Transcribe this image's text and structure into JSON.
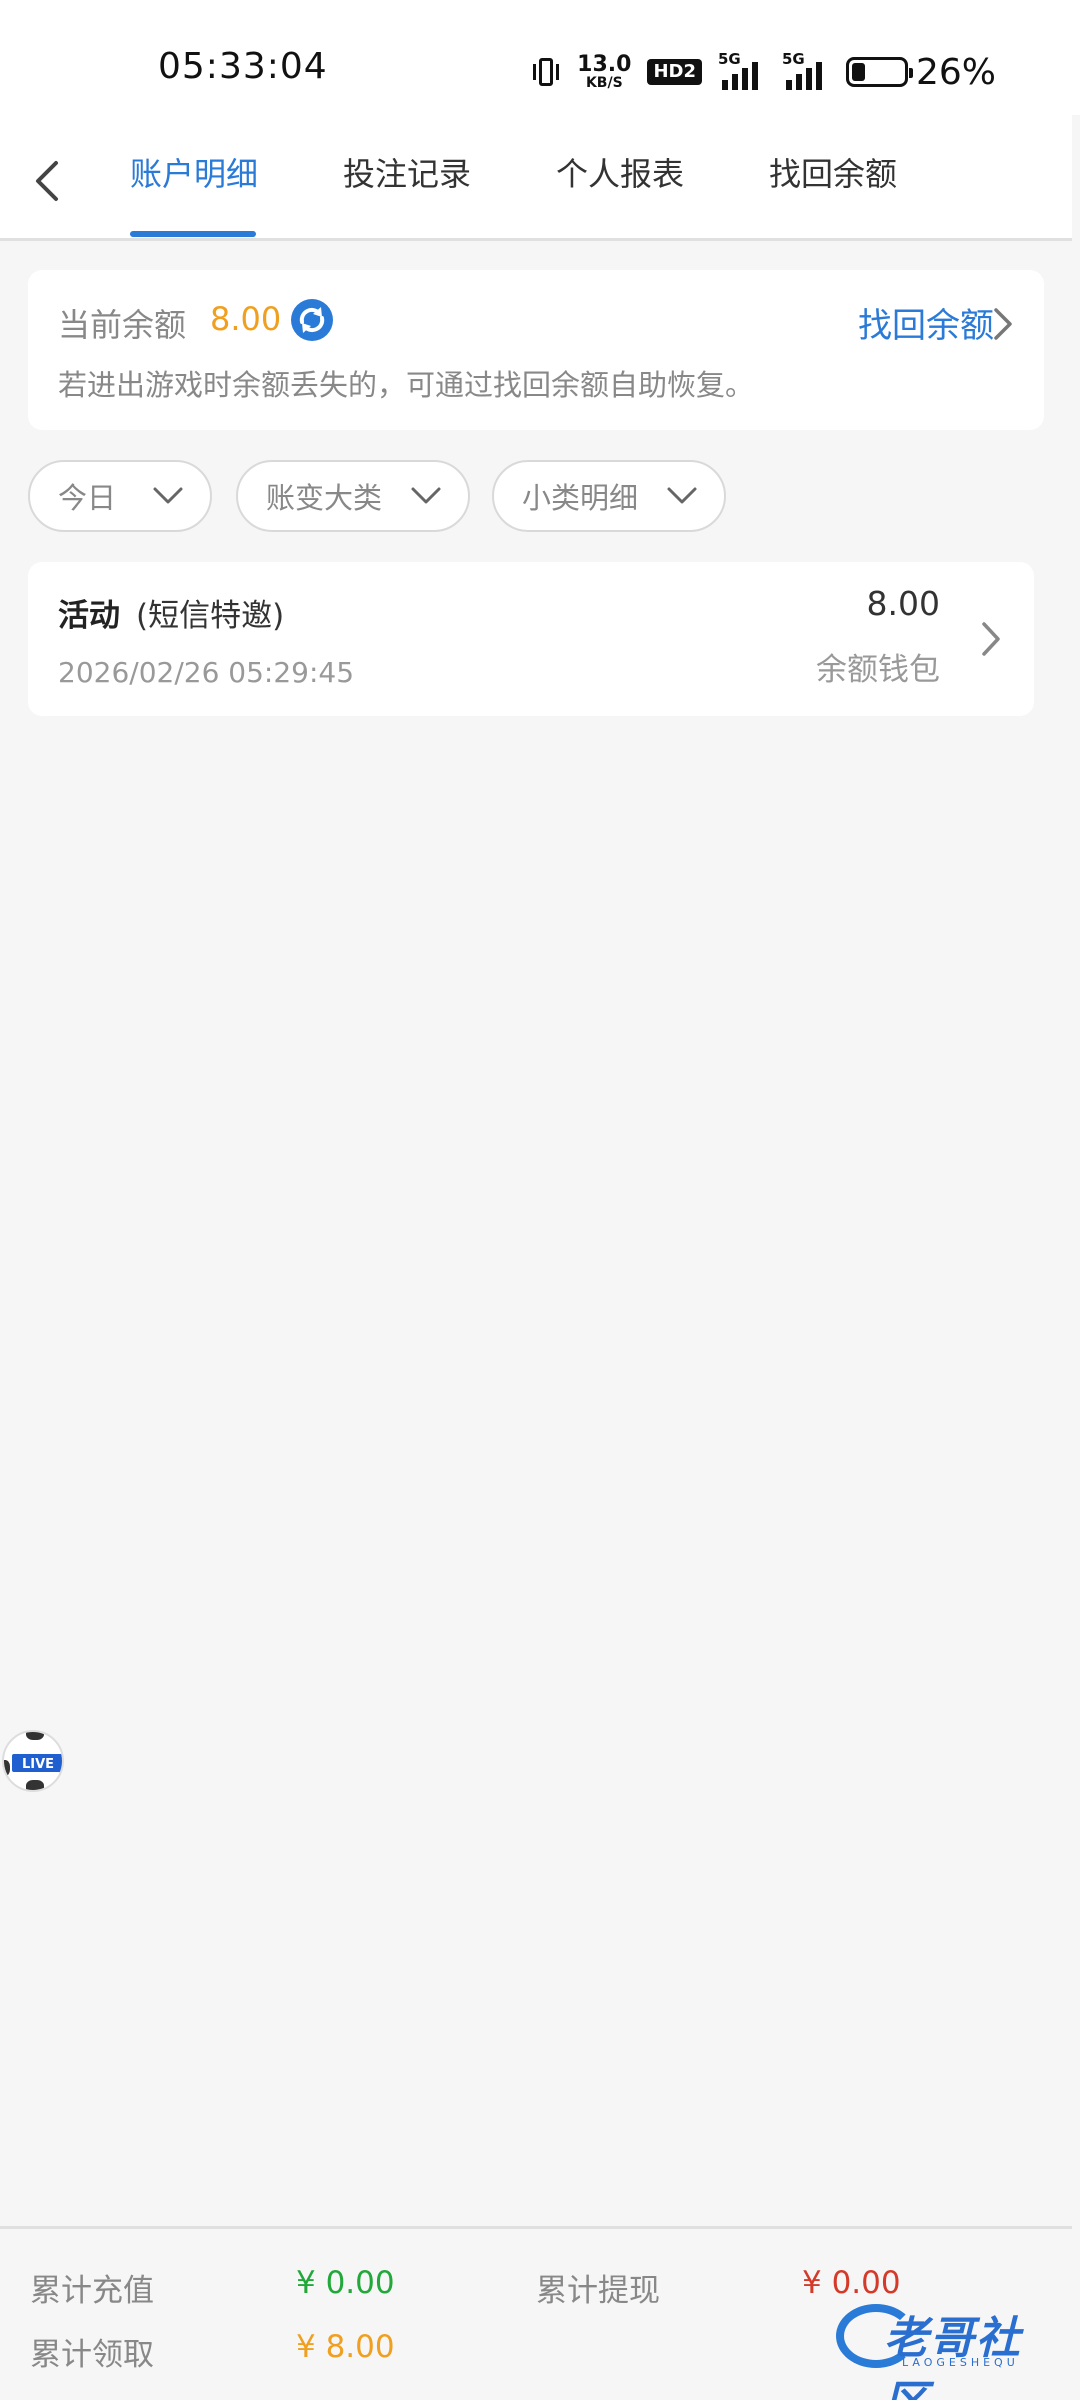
{
  "status_bar": {
    "time": "05:33:04",
    "net_speed_value": "13.0",
    "net_speed_unit": "KB/S",
    "hd_label": "HD2",
    "signal1_label": "5G",
    "signal2_label": "5G",
    "battery_percent": "26%",
    "icons": [
      "vibrate-icon",
      "hd-icon",
      "signal-icon",
      "signal-icon",
      "battery-icon"
    ]
  },
  "tabs": [
    {
      "label": "账户明细",
      "active": true
    },
    {
      "label": "投注记录",
      "active": false
    },
    {
      "label": "个人报表",
      "active": false
    },
    {
      "label": "找回余额",
      "active": false
    }
  ],
  "balance": {
    "label": "当前余额",
    "value": "8.00",
    "recover_label": "找回余额",
    "hint": "若进出游戏时余额丢失的，可通过找回余额自助恢复。"
  },
  "filters": [
    {
      "label": "今日"
    },
    {
      "label": "账变大类"
    },
    {
      "label": "小类明细"
    }
  ],
  "records": [
    {
      "title": "活动",
      "subtitle": "(短信特邀)",
      "date": "2026/02/26 05:29:45",
      "amount": "8.00",
      "wallet": "余额钱包"
    }
  ],
  "floating": {
    "live_label": "LIVE"
  },
  "summary": {
    "recharge_label": "累计充值",
    "recharge_value": "¥ 0.00",
    "withdraw_label": "累计提现",
    "withdraw_value": "¥ 0.00",
    "claimed_label": "累计领取",
    "claimed_value": "¥ 8.00"
  },
  "watermark": {
    "text": "老哥社区",
    "sub": "LAOGESHEQU"
  },
  "colors": {
    "accent": "#2a7ad8",
    "balance": "#f0a020",
    "recharge": "#22a83a",
    "withdraw": "#d43a2a",
    "claimed": "#f0a020"
  }
}
